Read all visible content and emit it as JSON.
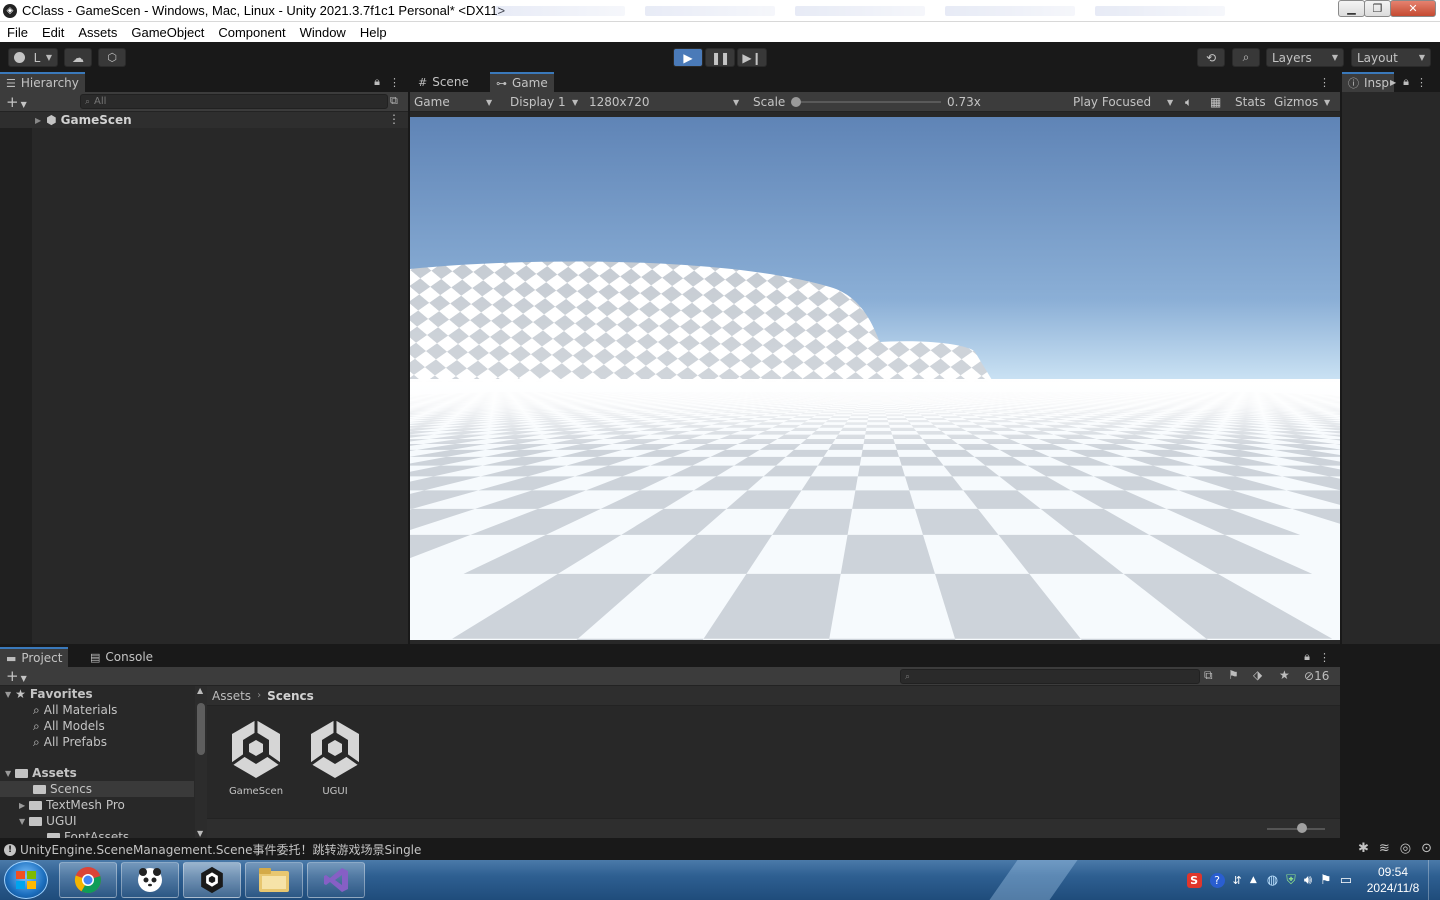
{
  "window": {
    "title": "CClass - GameScen - Windows, Mac, Linux - Unity 2021.3.7f1c1 Personal* <DX11>"
  },
  "menu": [
    "File",
    "Edit",
    "Assets",
    "GameObject",
    "Component",
    "Window",
    "Help"
  ],
  "toolbar": {
    "account_label": "L",
    "layers_label": "Layers",
    "layout_label": "Layout"
  },
  "hierarchy": {
    "tab_label": "Hierarchy",
    "search_placeholder": "All",
    "root_item": "GameScen"
  },
  "game_view": {
    "tabs": [
      "Scene",
      "Game"
    ],
    "active_tab": "Game",
    "mode": "Game",
    "display": "Display 1",
    "resolution": "1280x720",
    "scale_label": "Scale",
    "scale_value": "0.73x",
    "scale_fraction": 0.0,
    "play_mode": "Play Focused",
    "stats_label": "Stats",
    "gizmos_label": "Gizmos"
  },
  "inspector": {
    "tab_label": "Insp"
  },
  "project": {
    "tabs": [
      "Project",
      "Console"
    ],
    "hidden_count": "16",
    "tree": {
      "favorites_label": "Favorites",
      "favorites": [
        "All Materials",
        "All Models",
        "All Prefabs"
      ],
      "assets_label": "Assets",
      "folders": [
        "Scencs",
        "TextMesh Pro",
        "UGUI",
        "FontAssets"
      ],
      "selected_folder": "Scencs"
    },
    "breadcrumb": [
      "Assets",
      "Scencs"
    ],
    "assets": [
      "GameScen",
      "UGUI"
    ]
  },
  "status": {
    "message": "UnityEngine.SceneManagement.Scene事件委托！跳转游戏场景Single"
  },
  "taskbar": {
    "time": "09:54",
    "date": "2024/11/8"
  },
  "colors": {
    "unity_bg": "#191919",
    "panel": "#282828",
    "panel_header": "#3c3c3c",
    "accent": "#3a79bb",
    "play_active": "#4a7ab8",
    "sky_top": "#5f84b6",
    "sky_horizon": "#d9ecf8",
    "ground_light": "#ffffff",
    "ground_dark": "#cdd3da"
  }
}
